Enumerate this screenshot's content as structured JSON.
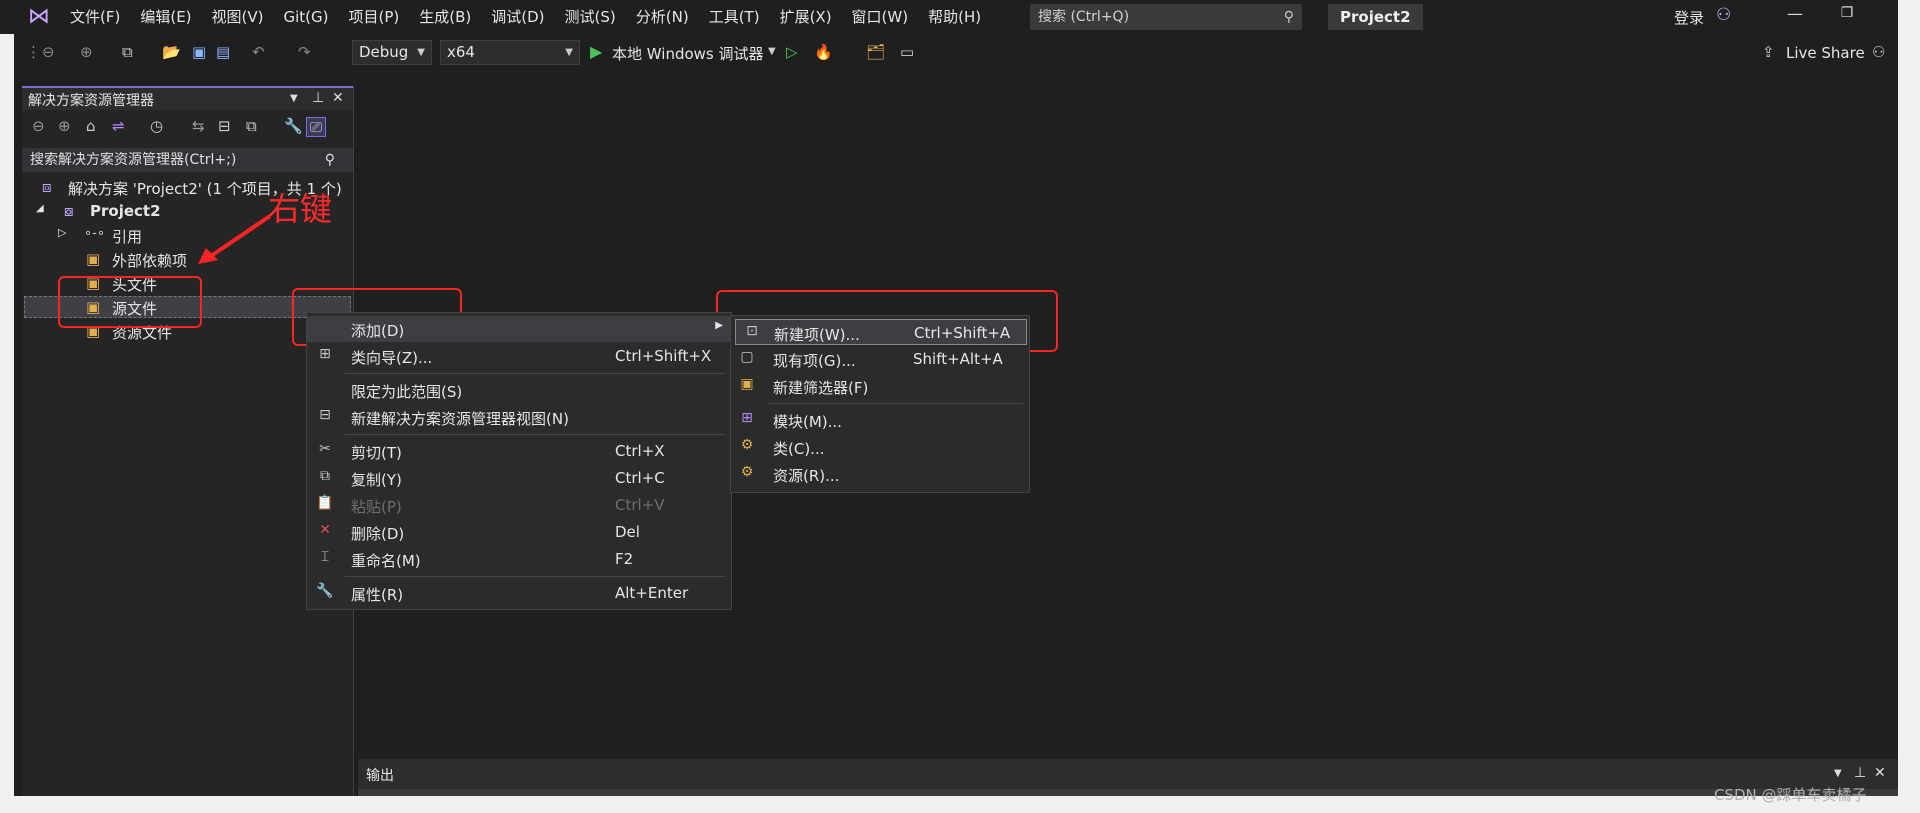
{
  "menubar": {
    "items": [
      "文件(F)",
      "编辑(E)",
      "视图(V)",
      "Git(G)",
      "项目(P)",
      "生成(B)",
      "调试(D)",
      "测试(S)",
      "分析(N)",
      "工具(T)",
      "扩展(X)",
      "窗口(W)",
      "帮助(H)"
    ],
    "search_placeholder": "搜索 (Ctrl+Q)",
    "project_name": "Project2",
    "signin": "登录"
  },
  "toolbar": {
    "config": "Debug",
    "platform": "x64",
    "run_label": "本地 Windows 调试器",
    "live_share": "Live Share"
  },
  "solution_explorer": {
    "title": "解决方案资源管理器",
    "search_placeholder": "搜索解决方案资源管理器(Ctrl+;)",
    "solution_label": "解决方案 'Project2' (1 个项目，共 1 个)",
    "project_label": "Project2",
    "items": [
      "引用",
      "外部依赖项",
      "头文件",
      "源文件",
      "资源文件"
    ]
  },
  "annotation": {
    "right_click_label": "右键"
  },
  "context_menu": {
    "add": {
      "label": "添加(D)",
      "shortcut": ""
    },
    "class_wizard": {
      "label": "类向导(Z)...",
      "shortcut": "Ctrl+Shift+X"
    },
    "scope_to_this": {
      "label": "限定为此范围(S)",
      "shortcut": ""
    },
    "new_view": {
      "label": "新建解决方案资源管理器视图(N)",
      "shortcut": ""
    },
    "cut": {
      "label": "剪切(T)",
      "shortcut": "Ctrl+X"
    },
    "copy": {
      "label": "复制(Y)",
      "shortcut": "Ctrl+C"
    },
    "paste": {
      "label": "粘贴(P)",
      "shortcut": "Ctrl+V"
    },
    "delete": {
      "label": "删除(D)",
      "shortcut": "Del"
    },
    "rename": {
      "label": "重命名(M)",
      "shortcut": "F2"
    },
    "properties": {
      "label": "属性(R)",
      "shortcut": "Alt+Enter"
    }
  },
  "submenu": {
    "new_item": {
      "label": "新建项(W)...",
      "shortcut": "Ctrl+Shift+A"
    },
    "existing_item": {
      "label": "现有项(G)...",
      "shortcut": "Shift+Alt+A"
    },
    "new_filter": {
      "label": "新建筛选器(F)",
      "shortcut": ""
    },
    "module": {
      "label": "模块(M)...",
      "shortcut": ""
    },
    "class": {
      "label": "类(C)...",
      "shortcut": ""
    },
    "resource": {
      "label": "资源(R)...",
      "shortcut": ""
    }
  },
  "output_panel": {
    "title": "输出"
  },
  "watermark": "CSDN @踩单车卖橘子",
  "colors": {
    "accent": "#7a6fd6",
    "annotation_red": "#ff2424",
    "run_green": "#4cc35a"
  }
}
